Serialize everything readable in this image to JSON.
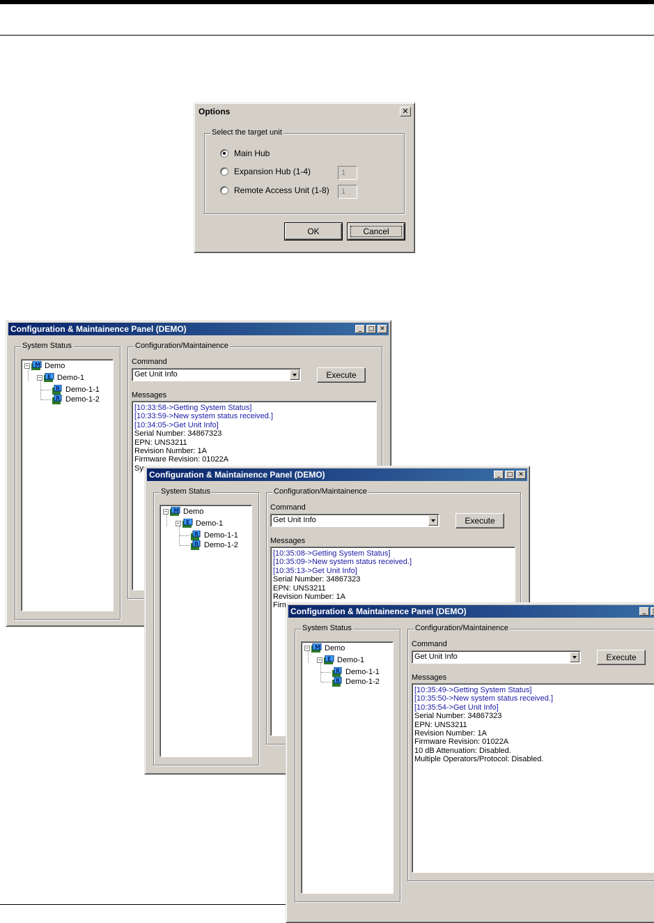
{
  "options_dialog": {
    "title": "Options",
    "close_glyph": "✕",
    "group_label": "Select the target unit",
    "radios": [
      {
        "label": "Main Hub",
        "checked": true
      },
      {
        "label": "Expansion Hub (1-4)",
        "value": "1"
      },
      {
        "label": "Remote Access Unit (1-8)",
        "value": "1"
      }
    ],
    "ok_label": "OK",
    "cancel_label": "Cancel"
  },
  "panels": [
    {
      "title": "Configuration & Maintainence Panel (DEMO)",
      "system_status_label": "System Status",
      "config_label": "Configuration/Maintainence",
      "command_label": "Command",
      "command_value": "Get Unit Info",
      "execute_label": "Execute",
      "messages_label": "Messages",
      "tree": [
        "Demo",
        "Demo-1",
        "Demo-1-1",
        "Demo-1-2"
      ],
      "messages": [
        {
          "text": "[10:33:58->Getting System Status]",
          "color": "blue"
        },
        {
          "text": "[10:33:59->New system status received.]",
          "color": "blue"
        },
        {
          "text": "[10:34:05->Get Unit Info]",
          "color": "blue"
        },
        {
          "text": "Serial Number: 34867323",
          "color": "black"
        },
        {
          "text": "EPN: UNS3211",
          "color": "black"
        },
        {
          "text": "Revision Number: 1A",
          "color": "black"
        },
        {
          "text": "Firmware Revision: 01022A",
          "color": "black"
        },
        {
          "text": "Sys",
          "color": "black"
        }
      ]
    },
    {
      "title": "Configuration & Maintainence Panel (DEMO)",
      "system_status_label": "System Status",
      "config_label": "Configuration/Maintainence",
      "command_label": "Command",
      "command_value": "Get Unit Info",
      "execute_label": "Execute",
      "messages_label": "Messages",
      "tree": [
        "Demo",
        "Demo-1",
        "Demo-1-1",
        "Demo-1-2"
      ],
      "messages": [
        {
          "text": "[10:35:08->Getting System Status]",
          "color": "blue"
        },
        {
          "text": "[10:35:09->New system status received.]",
          "color": "blue"
        },
        {
          "text": "[10:35:13->Get Unit Info]",
          "color": "blue"
        },
        {
          "text": "Serial Number: 34867323",
          "color": "black"
        },
        {
          "text": "EPN: UNS3211",
          "color": "black"
        },
        {
          "text": "Revision Number: 1A",
          "color": "black"
        },
        {
          "text": "Firm",
          "color": "black"
        }
      ]
    },
    {
      "title": "Configuration & Maintainence Panel (DEMO)",
      "system_status_label": "System Status",
      "config_label": "Configuration/Maintainence",
      "command_label": "Command",
      "command_value": "Get Unit Info",
      "execute_label": "Execute",
      "messages_label": "Messages",
      "tree": [
        "Demo",
        "Demo-1",
        "Demo-1-1",
        "Demo-1-2"
      ],
      "messages": [
        {
          "text": "[10:35:49->Getting System Status]",
          "color": "blue"
        },
        {
          "text": "[10:35:50->New system status received.]",
          "color": "blue"
        },
        {
          "text": "[10:35:54->Get Unit Info]",
          "color": "blue"
        },
        {
          "text": "Serial Number: 34867323",
          "color": "black"
        },
        {
          "text": "EPN: UNS3211",
          "color": "black"
        },
        {
          "text": "Revision Number: 1A",
          "color": "black"
        },
        {
          "text": "Firmware Revision: 01022A",
          "color": "black"
        },
        {
          "text": "10 dB Attenuation: Disabled.",
          "color": "black"
        },
        {
          "text": "Multiple Operators/Protocol: Disabled.",
          "color": "black"
        }
      ]
    }
  ],
  "window_buttons": {
    "minimize": "_",
    "maximize": "□",
    "close": "✕"
  },
  "colors": {
    "blue_text": "#1a1aa6",
    "title_active": "#0a246a",
    "chrome": "#d4d0c8"
  }
}
